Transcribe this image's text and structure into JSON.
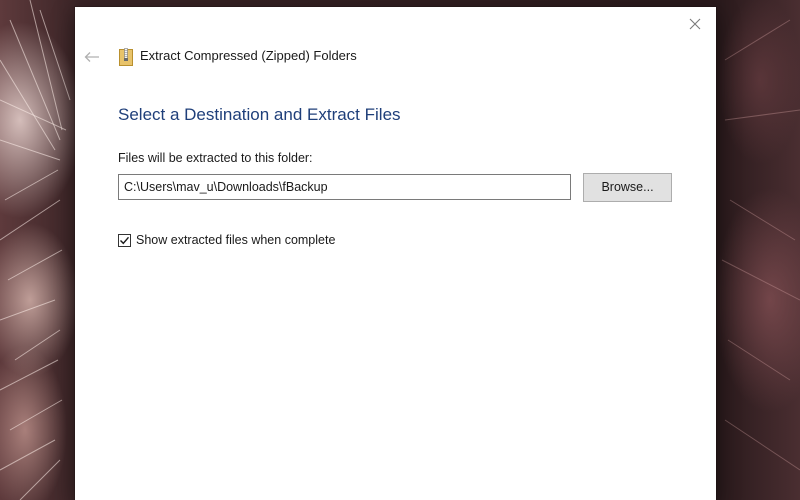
{
  "window": {
    "title": "Extract Compressed (Zipped) Folders"
  },
  "main": {
    "heading": "Select a Destination and Extract Files",
    "field_label": "Files will be extracted to this folder:",
    "destination_path": "C:\\Users\\mav_u\\Downloads\\fBackup",
    "browse_label": "Browse...",
    "show_files_checkbox": {
      "label": "Show extracted files when complete",
      "checked": true
    }
  },
  "icons": {
    "back": "back-arrow-icon",
    "close": "close-icon",
    "zip": "zip-folder-icon",
    "check": "checkmark-icon"
  },
  "colors": {
    "heading": "#1f3f7a",
    "button_face": "#e1e1e1",
    "dialog_bg": "#ffffff"
  }
}
